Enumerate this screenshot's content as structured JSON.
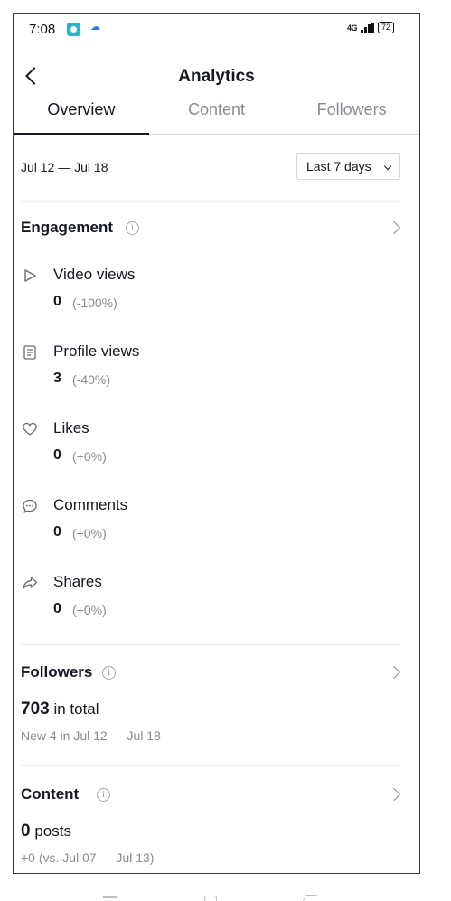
{
  "status_bar": {
    "time": "7:08",
    "network": "4G",
    "battery": "72"
  },
  "header": {
    "title": "Analytics"
  },
  "tabs": [
    {
      "label": "Overview",
      "active": true
    },
    {
      "label": "Content",
      "active": false
    },
    {
      "label": "Followers",
      "active": false
    }
  ],
  "date": {
    "range": "Jul 12 — Jul 18",
    "period_select": "Last 7 days"
  },
  "engagement": {
    "title": "Engagement",
    "metrics": [
      {
        "label": "Video views",
        "value": "0",
        "change": "(-100%)",
        "icon": "play-icon"
      },
      {
        "label": "Profile views",
        "value": "3",
        "change": "(-40%)",
        "icon": "profile-doc-icon"
      },
      {
        "label": "Likes",
        "value": "0",
        "change": "(+0%)",
        "icon": "heart-icon"
      },
      {
        "label": "Comments",
        "value": "0",
        "change": "(+0%)",
        "icon": "comment-icon"
      },
      {
        "label": "Shares",
        "value": "0",
        "change": "(+0%)",
        "icon": "share-icon"
      }
    ]
  },
  "followers": {
    "title": "Followers",
    "total_value": "703",
    "total_suffix": "in total",
    "new_text": "New 4 in Jul 12 — Jul 18"
  },
  "content": {
    "title": "Content",
    "posts_value": "0",
    "posts_suffix": "posts",
    "compare_text": "+0 (vs. Jul 07 — Jul 13)"
  },
  "colors": {
    "text": "#161823",
    "muted": "#8a8b91",
    "divider": "#ececec"
  }
}
